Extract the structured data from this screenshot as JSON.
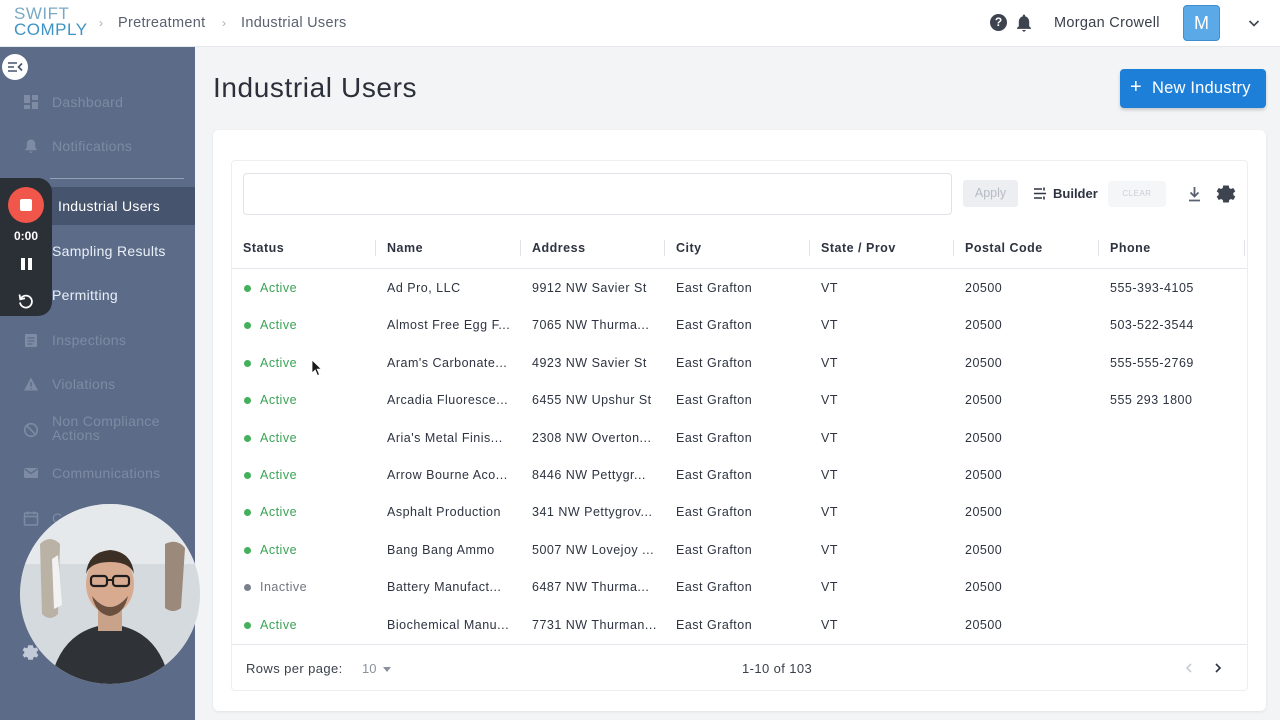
{
  "header": {
    "logo_line1": "SWIFT",
    "logo_line2": "COMPLY",
    "breadcrumbs": [
      "Pretreatment",
      "Industrial Users"
    ],
    "user_name": "Morgan Crowell",
    "avatar_letter": "M",
    "icons": [
      "help-icon",
      "bell-icon",
      "chevron-down-icon"
    ]
  },
  "sidebar": {
    "items": [
      {
        "label": "Dashboard",
        "icon": "dashboard-icon"
      },
      {
        "label": "Notifications",
        "icon": "bell-icon"
      },
      {
        "label": "Industrial Users",
        "icon": "industry-icon",
        "active": true
      },
      {
        "label": "Sampling Results",
        "icon": "flask-icon"
      },
      {
        "label": "Permitting",
        "icon": "permit-icon"
      },
      {
        "label": "Inspections",
        "icon": "clipboard-icon"
      },
      {
        "label": "Violations",
        "icon": "warning-icon"
      },
      {
        "label": "Non Compliance Actions",
        "icon": "block-icon"
      },
      {
        "label": "Communications",
        "icon": "mail-icon"
      },
      {
        "label": "C",
        "icon": "calendar-icon"
      }
    ]
  },
  "recorder": {
    "time": "0:00"
  },
  "main": {
    "title": "Industrial Users",
    "new_button_label": "New Industry",
    "new_button_icon": "plus-icon"
  },
  "toolbar": {
    "filter_value": "",
    "apply_label": "Apply",
    "builder_label": "Builder",
    "clear_label": "CLEAR"
  },
  "table": {
    "columns": [
      "Status",
      "Name",
      "Address",
      "City",
      "State / Prov",
      "Postal Code",
      "Phone"
    ],
    "rows": [
      {
        "status": "Active",
        "name": "Ad Pro, LLC",
        "address": "9912 NW Savier St",
        "city": "East Grafton",
        "state": "VT",
        "postal": "20500",
        "phone": "555-393-4105"
      },
      {
        "status": "Active",
        "name": "Almost Free Egg F...",
        "address": "7065 NW Thurma...",
        "city": "East Grafton",
        "state": "VT",
        "postal": "20500",
        "phone": "503-522-3544"
      },
      {
        "status": "Active",
        "name": "Aram's Carbonate...",
        "address": "4923 NW Savier St",
        "city": "East Grafton",
        "state": "VT",
        "postal": "20500",
        "phone": "555-555-2769"
      },
      {
        "status": "Active",
        "name": "Arcadia Fluoresce...",
        "address": "6455 NW Upshur St",
        "city": "East Grafton",
        "state": "VT",
        "postal": "20500",
        "phone": "555 293 1800"
      },
      {
        "status": "Active",
        "name": "Aria's Metal Finis...",
        "address": "2308 NW Overton...",
        "city": "East Grafton",
        "state": "VT",
        "postal": "20500",
        "phone": ""
      },
      {
        "status": "Active",
        "name": "Arrow Bourne Aco...",
        "address": "8446 NW Pettygr...",
        "city": "East Grafton",
        "state": "VT",
        "postal": "20500",
        "phone": ""
      },
      {
        "status": "Active",
        "name": "Asphalt Production",
        "address": "341 NW Pettygrov...",
        "city": "East Grafton",
        "state": "VT",
        "postal": "20500",
        "phone": ""
      },
      {
        "status": "Active",
        "name": "Bang Bang Ammo",
        "address": "5007 NW Lovejoy ...",
        "city": "East Grafton",
        "state": "VT",
        "postal": "20500",
        "phone": ""
      },
      {
        "status": "Inactive",
        "name": "Battery Manufact...",
        "address": "6487 NW Thurma...",
        "city": "East Grafton",
        "state": "VT",
        "postal": "20500",
        "phone": ""
      },
      {
        "status": "Active",
        "name": "Biochemical Manu...",
        "address": "7731 NW Thurman...",
        "city": "East Grafton",
        "state": "VT",
        "postal": "20500",
        "phone": ""
      }
    ]
  },
  "pagination": {
    "rows_per_page_label": "Rows per page:",
    "rows_per_page_value": "10",
    "range_text": "1-10 of 103"
  },
  "colors": {
    "active": "#43b05c",
    "inactive": "#7b818b",
    "active_text": "#3aa356",
    "inactive_text": "#70767f",
    "primary": "#1e7fd8",
    "sidebar": "#5b6b88"
  }
}
